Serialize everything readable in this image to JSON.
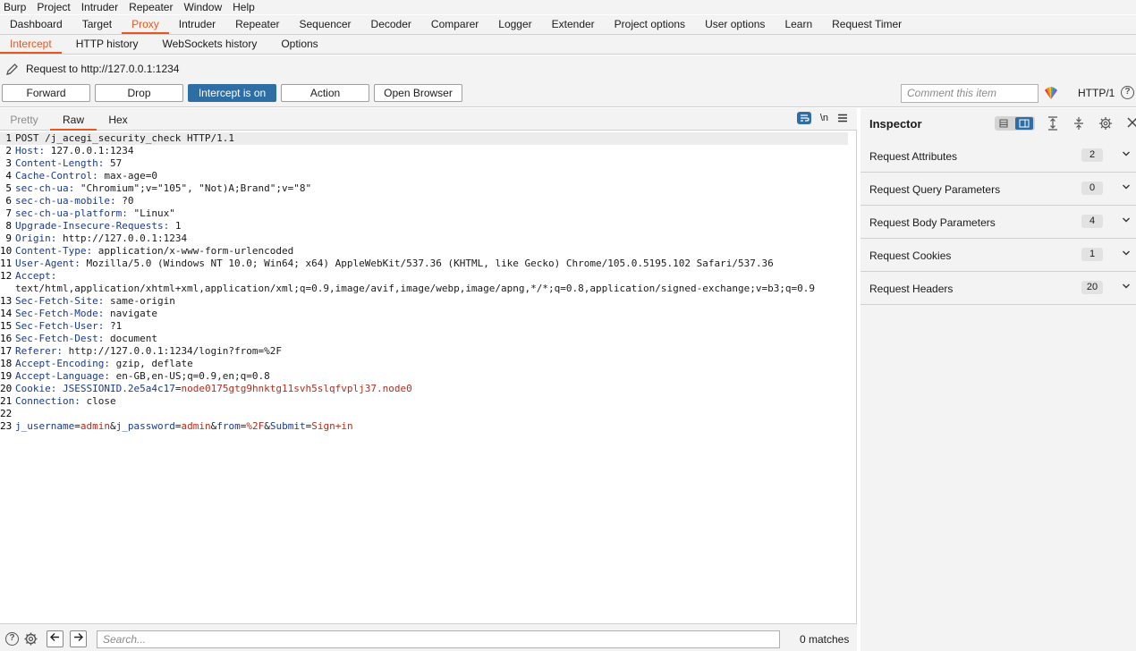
{
  "menu": [
    "Burp",
    "Project",
    "Intruder",
    "Repeater",
    "Window",
    "Help"
  ],
  "main_tabs": [
    "Dashboard",
    "Target",
    "Proxy",
    "Intruder",
    "Repeater",
    "Sequencer",
    "Decoder",
    "Comparer",
    "Logger",
    "Extender",
    "Project options",
    "User options",
    "Learn",
    "Request Timer"
  ],
  "main_active": "Proxy",
  "sub_tabs": [
    "Intercept",
    "HTTP history",
    "WebSockets history",
    "Options"
  ],
  "sub_active": "Intercept",
  "request_title": "Request to http://127.0.0.1:1234",
  "buttons": {
    "forward": "Forward",
    "drop": "Drop",
    "intercept": "Intercept is on",
    "action": "Action",
    "open_browser": "Open Browser"
  },
  "comment_placeholder": "Comment this item",
  "http_version": "HTTP/1",
  "editor_tabs": {
    "pretty": "Pretty",
    "raw": "Raw",
    "hex": "Hex"
  },
  "newline_toggle": "\\n",
  "lines": [
    {
      "n": "1",
      "k": "POST /j_acegi_security_check HTTP/1.1",
      "v": ""
    },
    {
      "n": "2",
      "k": "Host",
      "v": "127.0.0.1:1234"
    },
    {
      "n": "3",
      "k": "Content-Length",
      "v": "57"
    },
    {
      "n": "4",
      "k": "Cache-Control",
      "v": "max-age=0"
    },
    {
      "n": "5",
      "k": "sec-ch-ua",
      "v": "\"Chromium\";v=\"105\", \"Not)A;Brand\";v=\"8\""
    },
    {
      "n": "6",
      "k": "sec-ch-ua-mobile",
      "v": "?0"
    },
    {
      "n": "7",
      "k": "sec-ch-ua-platform",
      "v": "\"Linux\""
    },
    {
      "n": "8",
      "k": "Upgrade-Insecure-Requests",
      "v": "1"
    },
    {
      "n": "9",
      "k": "Origin",
      "v": "http://127.0.0.1:1234"
    },
    {
      "n": "10",
      "k": "Content-Type",
      "v": "application/x-www-form-urlencoded"
    },
    {
      "n": "11",
      "k": "User-Agent",
      "v": "Mozilla/5.0 (Windows NT 10.0; Win64; x64) AppleWebKit/537.36 (KHTML, like Gecko) Chrome/105.0.5195.102 Safari/537.36"
    },
    {
      "n": "12",
      "k": "Accept",
      "v": "text/html,application/xhtml+xml,application/xml;q=0.9,image/avif,image/webp,image/apng,*/*;q=0.8,application/signed-exchange;v=b3;q=0.9"
    },
    {
      "n": "13",
      "k": "Sec-Fetch-Site",
      "v": "same-origin"
    },
    {
      "n": "14",
      "k": "Sec-Fetch-Mode",
      "v": "navigate"
    },
    {
      "n": "15",
      "k": "Sec-Fetch-User",
      "v": "?1"
    },
    {
      "n": "16",
      "k": "Sec-Fetch-Dest",
      "v": "document"
    },
    {
      "n": "17",
      "k": "Referer",
      "v": "http://127.0.0.1:1234/login?from=%2F"
    },
    {
      "n": "18",
      "k": "Accept-Encoding",
      "v": "gzip, deflate"
    },
    {
      "n": "19",
      "k": "Accept-Language",
      "v": "en-GB,en-US;q=0.9,en;q=0.8"
    },
    {
      "n": "20",
      "k": "Cookie",
      "v": ""
    },
    {
      "n": "21",
      "k": "Connection",
      "v": "close"
    },
    {
      "n": "22",
      "k": "",
      "v": ""
    },
    {
      "n": "23",
      "k": "",
      "v": ""
    }
  ],
  "cookie": {
    "name": "JSESSIONID.2e5a4c17",
    "value": "node0175gtg9hnktg11svh5slqfvplj37.node0"
  },
  "body_params": [
    {
      "k": "j_username",
      "v": "admin"
    },
    {
      "k": "j_password",
      "v": "admin"
    },
    {
      "k": "from",
      "v": "%2F"
    },
    {
      "k": "Submit",
      "v": "Sign+in"
    }
  ],
  "search_placeholder": "Search...",
  "matches": "0 matches",
  "inspector": {
    "title": "Inspector",
    "sections": [
      {
        "name": "Request Attributes",
        "count": "2"
      },
      {
        "name": "Request Query Parameters",
        "count": "0"
      },
      {
        "name": "Request Body Parameters",
        "count": "4"
      },
      {
        "name": "Request Cookies",
        "count": "1"
      },
      {
        "name": "Request Headers",
        "count": "20"
      }
    ]
  },
  "colors": {
    "accent": "#e8571f",
    "primary": "#2f6ea5"
  }
}
